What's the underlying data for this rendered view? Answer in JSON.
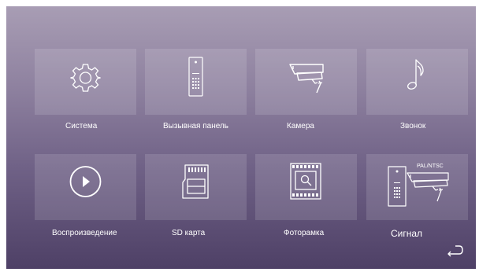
{
  "menu": {
    "items": [
      {
        "key": "system",
        "label": "Система",
        "icon": "gear-icon"
      },
      {
        "key": "door-panel",
        "label": "Вызывная панель",
        "icon": "door-panel-icon"
      },
      {
        "key": "camera",
        "label": "Камера",
        "icon": "cctv-camera-icon"
      },
      {
        "key": "ringtone",
        "label": "Звонок",
        "icon": "music-note-icon"
      },
      {
        "key": "playback",
        "label": "Воспроизведение",
        "icon": "play-icon"
      },
      {
        "key": "sd-card",
        "label": "SD карта",
        "icon": "sd-card-icon"
      },
      {
        "key": "photo-frame",
        "label": "Фоторамка",
        "icon": "photo-frame-icon"
      },
      {
        "key": "signal",
        "label": "Сигнал",
        "icon": "signal-icon",
        "badge": "PAL/NTSC"
      }
    ]
  },
  "back": {
    "icon": "back-arrow-icon"
  }
}
